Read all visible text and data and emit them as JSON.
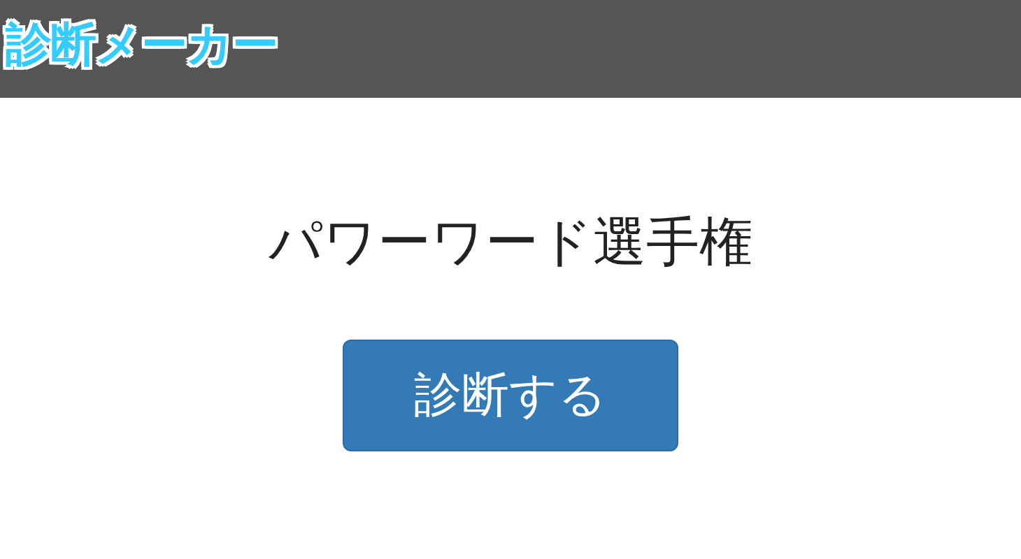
{
  "header": {
    "logo": "診断メーカー"
  },
  "title": "パワーワード選手権",
  "button": "診断する"
}
